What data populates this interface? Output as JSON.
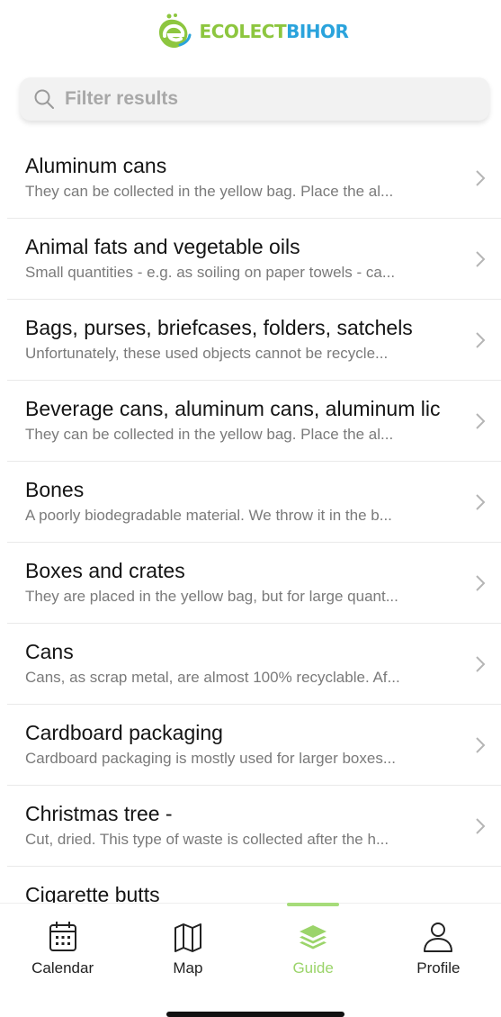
{
  "header": {
    "logo_part1": "ECOLECT",
    "logo_part2": "BIHOR",
    "logo_icon": "leaf-e-logo-icon"
  },
  "search": {
    "placeholder": "Filter results",
    "value": "",
    "icon": "search-icon"
  },
  "items": [
    {
      "title": "Aluminum cans",
      "desc": "They can be collected in the yellow bag. Place the al..."
    },
    {
      "title": "Animal fats and vegetable oils",
      "desc": "Small quantities - e.g. as soiling on paper towels - ca..."
    },
    {
      "title": "Bags, purses, briefcases, folders, satchels",
      "desc": "Unfortunately, these used objects cannot be recycle..."
    },
    {
      "title": "Beverage cans, aluminum cans, aluminum lic",
      "desc": "They can be collected in the yellow bag. Place the al..."
    },
    {
      "title": "Bones",
      "desc": "A poorly biodegradable material. We throw it in the b..."
    },
    {
      "title": "Boxes and crates",
      "desc": "They are placed in the yellow bag, but for large quant..."
    },
    {
      "title": "Cans",
      "desc": "Cans, as scrap metal, are almost 100% recyclable. Af..."
    },
    {
      "title": "Cardboard packaging",
      "desc": "Cardboard packaging is mostly used for larger boxes..."
    },
    {
      "title": "Christmas tree -",
      "desc": "Cut, dried. This type of waste is collected after the h..."
    },
    {
      "title": "Cigarette butts",
      "desc": ""
    }
  ],
  "tabs": [
    {
      "label": "Calendar",
      "icon": "calendar-icon",
      "active": false
    },
    {
      "label": "Map",
      "icon": "map-icon",
      "active": false
    },
    {
      "label": "Guide",
      "icon": "layers-icon",
      "active": true
    },
    {
      "label": "Profile",
      "icon": "user-icon",
      "active": false
    }
  ],
  "colors": {
    "accent_green": "#8dc63f",
    "accent_blue": "#2aa3dc",
    "active_tab": "#9bd46a"
  }
}
